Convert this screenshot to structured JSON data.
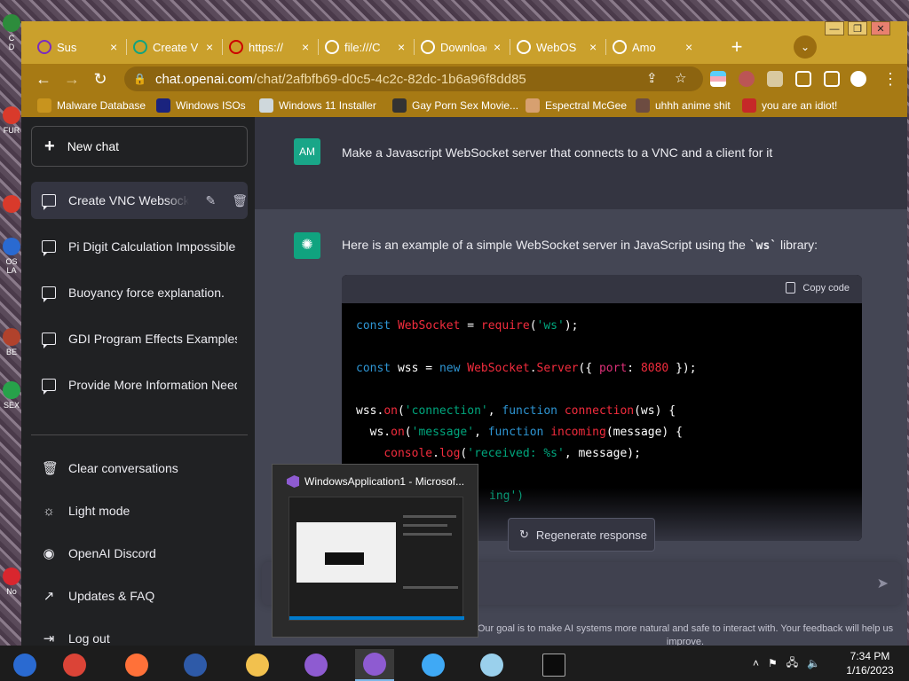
{
  "desktop": {
    "icons": [
      {
        "label": "C\nD",
        "color": "#2d8c3c"
      },
      {
        "label": "FUR",
        "color": "#d93a2b"
      },
      {
        "label": "",
        "color": "#d93a2b"
      },
      {
        "label": "OS\nLA",
        "color": "#2a6ad1"
      },
      {
        "label": "BE",
        "color": "#b1422c"
      },
      {
        "label": "SEX",
        "color": "#27a24a"
      },
      {
        "label": "No",
        "color": "#d9262e"
      }
    ]
  },
  "browser": {
    "tabs": [
      {
        "title": "Sus",
        "favicon_color": "#7b2cbf"
      },
      {
        "title": "Create V",
        "favicon_color": "#10a37f"
      },
      {
        "title": "https://",
        "favicon_color": "#cc0000"
      },
      {
        "title": "file:///C",
        "favicon_color": "#ffffff"
      },
      {
        "title": "Download",
        "favicon_color": "#ffffff"
      },
      {
        "title": "WebOS",
        "favicon_color": "#ffffff"
      },
      {
        "title": "Amo",
        "favicon_color": "#ffffff"
      }
    ],
    "tab_close_glyph": "×",
    "new_tab_glyph": "+",
    "tab_search_glyph": "⌄",
    "window_controls": [
      "—",
      "❐",
      "✕"
    ],
    "url_host": "chat.openai.com",
    "url_path": "/chat/2afbfb69-d0c5-4c2c-82dc-1b6a96f8dd85",
    "nav": {
      "back": "←",
      "forward": "→",
      "reload": "↻"
    },
    "bookmarks": [
      {
        "label": "Malware Database",
        "icon_color": "#c8941e"
      },
      {
        "label": "Windows ISOs",
        "icon_color": "#1a237e"
      },
      {
        "label": "Windows 11 Installer",
        "icon_color": "#cfd8dc"
      },
      {
        "label": "Gay Porn Sex Movie...",
        "icon_color": "#333333"
      },
      {
        "label": "Espectral McGee",
        "icon_color": "#d7a070"
      },
      {
        "label": "uhhh anime shit",
        "icon_color": "#6d4c41"
      },
      {
        "label": "you are an idiot!",
        "icon_color": "#c62828"
      }
    ]
  },
  "sidebar": {
    "new_chat": "New chat",
    "conversations": [
      {
        "label": "Create VNC Websocket Se"
      },
      {
        "label": "Pi Digit Calculation Impossible"
      },
      {
        "label": "Buoyancy force explanation."
      },
      {
        "label": "GDI Program Effects Examples"
      },
      {
        "label": "Provide More Information Neede"
      }
    ],
    "bottom": [
      {
        "label": "Clear conversations",
        "icon": "🗑"
      },
      {
        "label": "Light mode",
        "icon": "☼"
      },
      {
        "label": "OpenAI Discord",
        "icon": "◉"
      },
      {
        "label": "Updates & FAQ",
        "icon": "↗"
      },
      {
        "label": "Log out",
        "icon": "⇥"
      }
    ]
  },
  "chat": {
    "user_avatar": "AM",
    "user_message": "Make a Javascript WebSocket server that connects to a VNC and a client for it",
    "bot_intro": "Here is an example of a simple WebSocket server in JavaScript using the",
    "bot_intro_code": "`ws`",
    "bot_intro_end": "library:",
    "copy_code": "Copy code",
    "code_lines": [
      "const WebSocket = require('ws');",
      "",
      "const wss = new WebSocket.Server({ port: 8080 });",
      "",
      "wss.on('connection', function connection(ws) {",
      "  ws.on('message', function incoming(message) {",
      "    console.log('received: %s', message);",
      "",
      "ing')"
    ],
    "regenerate": "Regenerate response",
    "footer": "Our goal is to make AI systems more natural and safe to interact with. Your feedback will help us improve."
  },
  "thumbnail": {
    "title": "WindowsApplication1 - Microsof..."
  },
  "taskbar": {
    "apps": [
      {
        "name": "app-1",
        "color": "#2a6ad1"
      },
      {
        "name": "chrome",
        "color": "#db4437"
      },
      {
        "name": "firefox",
        "color": "#ff7139"
      },
      {
        "name": "app-4",
        "color": "#2e5aa8"
      },
      {
        "name": "file-explorer",
        "color": "#f2c14e"
      },
      {
        "name": "visual-studio-installer",
        "color": "#8e5bd1"
      },
      {
        "name": "visual-studio",
        "color": "#8e5bd1"
      },
      {
        "name": "app-8",
        "color": "#3fa9f5"
      },
      {
        "name": "app-9",
        "color": "#9ad0ec"
      },
      {
        "name": "terminal",
        "color": "#0c0c0c"
      }
    ],
    "time": "7:34 PM",
    "date": "1/16/2023",
    "tray": [
      "˄",
      "⚑",
      "🖧",
      "🔈"
    ]
  }
}
